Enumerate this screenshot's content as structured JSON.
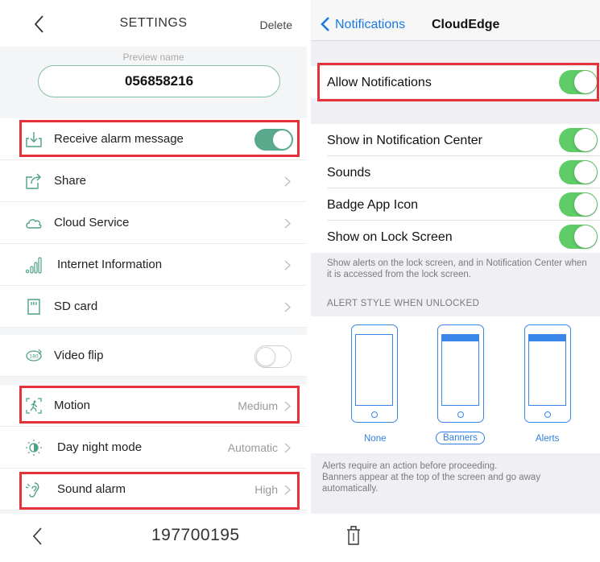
{
  "left_panel": {
    "header": {
      "title": "SETTINGS",
      "delete_label": "Delete"
    },
    "preview": {
      "label": "Preview name",
      "value": "056858216"
    },
    "rows": [
      {
        "label": "Receive alarm message",
        "icon": "download-icon",
        "control": "toggle",
        "toggle_on": true
      },
      {
        "label": "Share",
        "icon": "share-icon",
        "control": "chevron"
      },
      {
        "label": "Cloud Service",
        "icon": "cloud-icon",
        "control": "chevron"
      },
      {
        "label": "Internet Information",
        "icon": "signal-icon",
        "control": "chevron"
      },
      {
        "label": "SD card",
        "icon": "sd-card-icon",
        "control": "chevron"
      },
      {
        "label": "Video flip",
        "icon": "flip-icon",
        "control": "toggle",
        "toggle_on": false
      },
      {
        "label": "Motion",
        "icon": "motion-icon",
        "control": "chevron",
        "value": "Medium"
      },
      {
        "label": "Day night mode",
        "icon": "day-night-icon",
        "control": "chevron",
        "value": "Automatic"
      },
      {
        "label": "Sound alarm",
        "icon": "sound-icon",
        "control": "chevron",
        "value": "High"
      }
    ],
    "accent_color": "#5aa98d",
    "highlight_color": "#e4313a"
  },
  "bottom_bar": {
    "title": "197700195",
    "icons": [
      "back-icon",
      "trash-icon"
    ]
  },
  "right_panel": {
    "nav": {
      "back_label": "Notifications",
      "title": "CloudEdge"
    },
    "allow": {
      "label": "Allow Notifications",
      "on": true
    },
    "cells": [
      {
        "label": "Show in Notification Center",
        "on": true
      },
      {
        "label": "Sounds",
        "on": true
      },
      {
        "label": "Badge App Icon",
        "on": true
      },
      {
        "label": "Show on Lock Screen",
        "on": true
      }
    ],
    "lock_note": "Show alerts on the lock screen, and in Notification Center when it is accessed from the lock screen.",
    "alert_section_title": "ALERT STYLE WHEN UNLOCKED",
    "alert_styles": [
      {
        "label": "None",
        "selected": false
      },
      {
        "label": "Banners",
        "selected": true
      },
      {
        "label": "Alerts",
        "selected": false
      }
    ],
    "footer_note": "Alerts require an action before proceeding.\nBanners appear at the top of the screen and go away automatically.",
    "toggle_color": "#5fcc68",
    "link_color": "#1a7ae0"
  }
}
